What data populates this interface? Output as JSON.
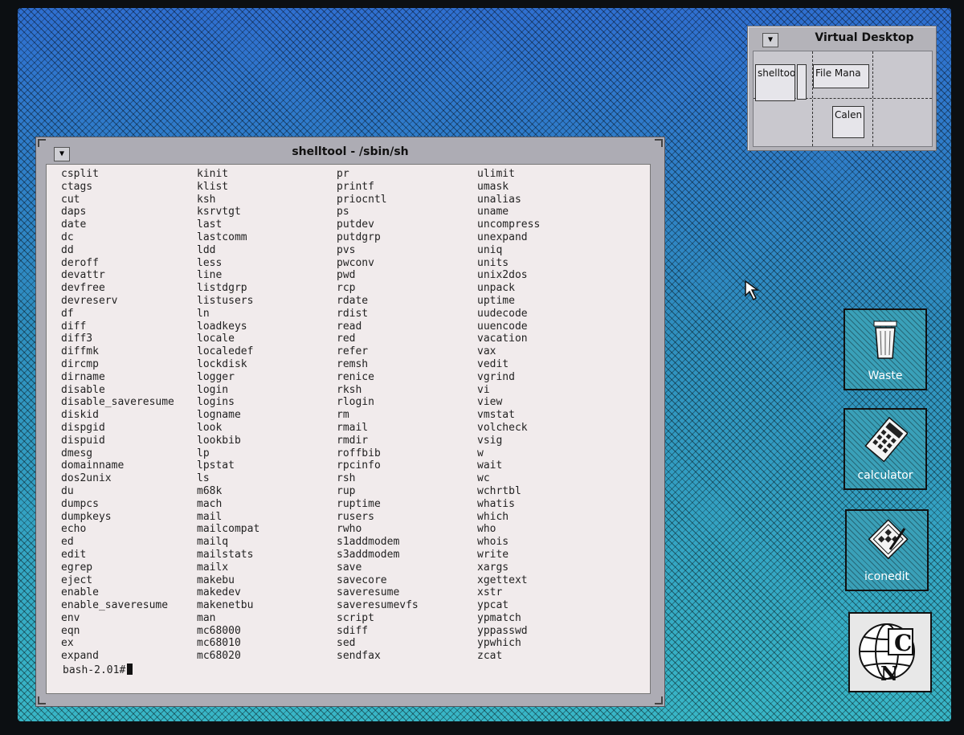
{
  "virtual_desktop": {
    "title": "Virtual Desktop",
    "menu_glyph": "▼",
    "windows": {
      "shelltool": "shelltool",
      "file_manager": "File Mana",
      "calendar": "Calen"
    }
  },
  "shelltool": {
    "title": "shelltool - /sbin/sh",
    "menu_glyph": "▼",
    "columns": [
      [
        "csplit",
        "ctags",
        "cut",
        "daps",
        "date",
        "dc",
        "dd",
        "deroff",
        "devattr",
        "devfree",
        "devreserv",
        "df",
        "diff",
        "diff3",
        "diffmk",
        "dircmp",
        "dirname",
        "disable",
        "disable_saveresume",
        "diskid",
        "dispgid",
        "dispuid",
        "dmesg",
        "domainname",
        "dos2unix",
        "du",
        "dumpcs",
        "dumpkeys",
        "echo",
        "ed",
        "edit",
        "egrep",
        "eject",
        "enable",
        "enable_saveresume",
        "env",
        "eqn",
        "ex",
        "expand"
      ],
      [
        "kinit",
        "klist",
        "ksh",
        "ksrvtgt",
        "last",
        "lastcomm",
        "ldd",
        "less",
        "line",
        "listdgrp",
        "listusers",
        "ln",
        "loadkeys",
        "locale",
        "localedef",
        "lockdisk",
        "logger",
        "login",
        "logins",
        "logname",
        "look",
        "lookbib",
        "lp",
        "lpstat",
        "ls",
        "m68k",
        "mach",
        "mail",
        "mailcompat",
        "mailq",
        "mailstats",
        "mailx",
        "makebu",
        "makedev",
        "makenetbu",
        "man",
        "mc68000",
        "mc68010",
        "mc68020"
      ],
      [
        "pr",
        "printf",
        "priocntl",
        "ps",
        "putdev",
        "putdgrp",
        "pvs",
        "pwconv",
        "pwd",
        "rcp",
        "rdate",
        "rdist",
        "read",
        "red",
        "refer",
        "remsh",
        "renice",
        "rksh",
        "rlogin",
        "rm",
        "rmail",
        "rmdir",
        "roffbib",
        "rpcinfo",
        "rsh",
        "rup",
        "ruptime",
        "rusers",
        "rwho",
        "s1addmodem",
        "s3addmodem",
        "save",
        "savecore",
        "saveresume",
        "saveresumevfs",
        "script",
        "sdiff",
        "sed",
        "sendfax"
      ],
      [
        "ulimit",
        "umask",
        "unalias",
        "uname",
        "uncompress",
        "unexpand",
        "uniq",
        "units",
        "unix2dos",
        "unpack",
        "uptime",
        "uudecode",
        "uuencode",
        "vacation",
        "vax",
        "vedit",
        "vgrind",
        "vi",
        "view",
        "vmstat",
        "volcheck",
        "vsig",
        "w",
        "wait",
        "wc",
        "wchrtbl",
        "whatis",
        "which",
        "who",
        "whois",
        "write",
        "xargs",
        "xgettext",
        "xstr",
        "ypcat",
        "ypmatch",
        "yppasswd",
        "ypwhich",
        "zcat"
      ]
    ],
    "prompt": "bash-2.01#"
  },
  "icons": {
    "waste": "Waste",
    "calculator": "calculator",
    "iconedit": "iconedit",
    "logo_letters": "CN"
  },
  "colors": {
    "desktop_blue": "#2f8fb4",
    "terminal_bg": "#f1ebec",
    "frame_gray": "#adacb4"
  }
}
